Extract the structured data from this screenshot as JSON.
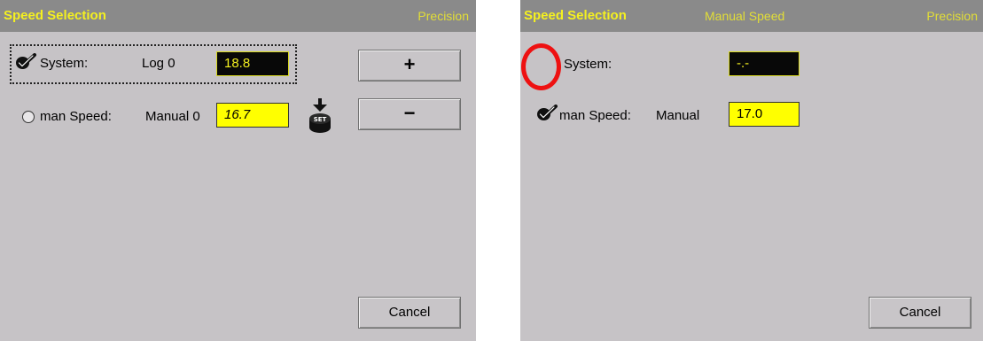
{
  "left_panel": {
    "title": "Speed Selection",
    "mode": "Precision",
    "system_row": {
      "label": "System:",
      "source": "Log 0",
      "value": "18.8",
      "selected": true
    },
    "man_speed_row": {
      "label": "man Speed:",
      "source": "Manual 0",
      "value": "16.7",
      "selected": false
    },
    "plus_button": "+",
    "minus_button": "−",
    "set_icon_label": "SET",
    "cancel_button": "Cancel"
  },
  "right_panel": {
    "title": "Speed Selection",
    "subtitle": "Manual Speed",
    "mode": "Precision",
    "system_row": {
      "label": "System:",
      "value": "-.-",
      "selected": false
    },
    "man_speed_row": {
      "label": "man Speed:",
      "source": "Manual",
      "value": "17.0",
      "selected": true
    },
    "cancel_button": "Cancel"
  },
  "colors": {
    "panel_bg": "#c6c3c6",
    "titlebar_bg": "#8a8a8a",
    "title_text": "#f4f020",
    "field_yellow": "#ffff00",
    "field_black": "#080808",
    "annotation_red": "#ee1111"
  }
}
